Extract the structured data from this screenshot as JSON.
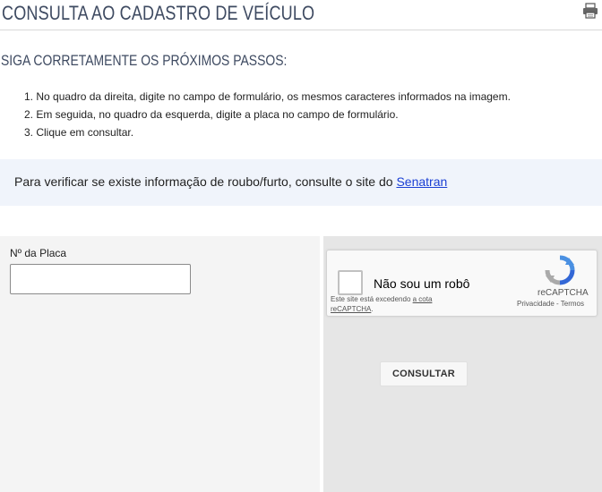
{
  "header": {
    "title": "CONSULTA AO CADASTRO DE VEÍCULO",
    "print_icon": "printer-icon"
  },
  "instructions": {
    "heading": "SIGA CORRETAMENTE OS PRÓXIMOS PASSOS:",
    "steps": [
      "1. No quadro da direita, digite no campo de formulário, os mesmos caracteres informados na imagem.",
      "2. Em seguida, no quadro da esquerda, digite a placa no campo de formulário.",
      "3. Clique em consultar."
    ]
  },
  "notice": {
    "text": "Para verificar se existe informação de roubo/furto, consulte o site do ",
    "link_label": "Senatran"
  },
  "form": {
    "plate_label": "Nº da Placa",
    "plate_value": "",
    "plate_placeholder": ""
  },
  "captcha": {
    "label": "Não sou um robô",
    "brand": "reCAPTCHA",
    "privacy_link": "Privacidade",
    "separator": " - ",
    "terms_link": "Termos",
    "quota_text": "Este site está excedendo ",
    "quota_link": "a cota reCAPTCHA",
    "quota_end": "."
  },
  "actions": {
    "consult_label": "CONSULTAR"
  },
  "colors": {
    "title": "#3e4a61",
    "link": "#1a3fd4",
    "notice_bg": "#f0f4fb",
    "left_panel_bg": "#f4f4f4",
    "right_panel_bg": "#e6e6e6"
  }
}
